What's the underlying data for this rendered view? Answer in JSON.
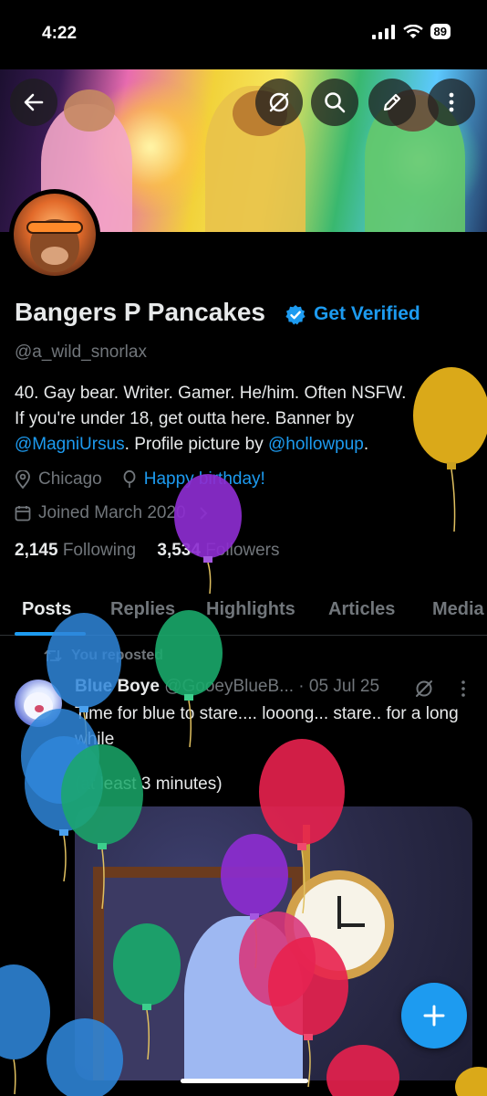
{
  "status": {
    "time": "4:22",
    "battery": "89"
  },
  "profile": {
    "name": "Bangers P Pancakes",
    "get_verified": "Get Verified",
    "handle": "@a_wild_snorlax",
    "bio": {
      "line1": "40. Gay bear. Writer. Gamer. He/him. Often NSFW.",
      "line2": "If you're under 18, get outta here.  Banner by",
      "mention1": "@MagniUrsus",
      "mid": ". Profile picture by ",
      "mention2": "@hollowpup",
      "end": "."
    },
    "location": "Chicago",
    "birthday": "Happy birthday!",
    "joined": "Joined March 2020",
    "following_count": "2,145",
    "following_label": "Following",
    "followers_count": "3,534",
    "followers_label": "Followers"
  },
  "tabs": [
    {
      "label": "Posts"
    },
    {
      "label": "Replies"
    },
    {
      "label": "Highlights"
    },
    {
      "label": "Articles"
    },
    {
      "label": "Media"
    }
  ],
  "post": {
    "repost_label": "You reposted",
    "author": "Blue Boye",
    "handle": "@GooeyBlueB...",
    "date": "· 05 Jul 25",
    "text": "Time for blue to stare.... looong... stare.. for a long while",
    "text2": "(at least 3 minutes)"
  },
  "colors": {
    "accent": "#1d9bf0",
    "background": "#000000",
    "muted": "#71767b"
  }
}
